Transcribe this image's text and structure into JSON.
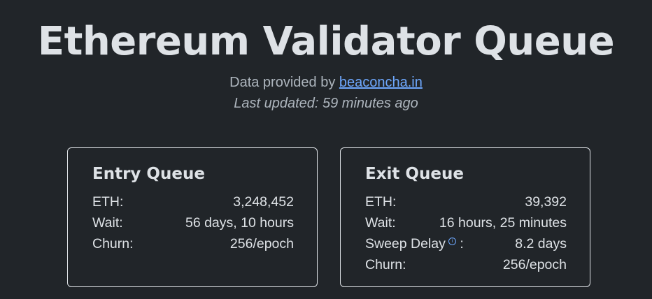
{
  "header": {
    "title": "Ethereum Validator Queue",
    "provided_prefix": "Data provided by ",
    "provider_link": "beaconcha.in",
    "last_updated": "Last updated: 59 minutes ago"
  },
  "entry_queue": {
    "title": "Entry Queue",
    "rows": [
      {
        "label": "ETH:",
        "value": "3,248,452"
      },
      {
        "label": "Wait:",
        "value": "56 days, 10 hours"
      },
      {
        "label": "Churn:",
        "value": "256/epoch"
      }
    ]
  },
  "exit_queue": {
    "title": "Exit Queue",
    "rows": [
      {
        "label": "ETH:",
        "value": "39,392"
      },
      {
        "label": "Wait:",
        "value": "16 hours, 25 minutes"
      },
      {
        "label": "Sweep Delay",
        "suffix": ":",
        "value": "8.2 days",
        "icon": "info-icon"
      },
      {
        "label": "Churn:",
        "value": "256/epoch"
      }
    ]
  },
  "colors": {
    "background": "#212529",
    "text": "#dee2e6",
    "muted": "#adb5bd",
    "link": "#6ea8fe"
  }
}
